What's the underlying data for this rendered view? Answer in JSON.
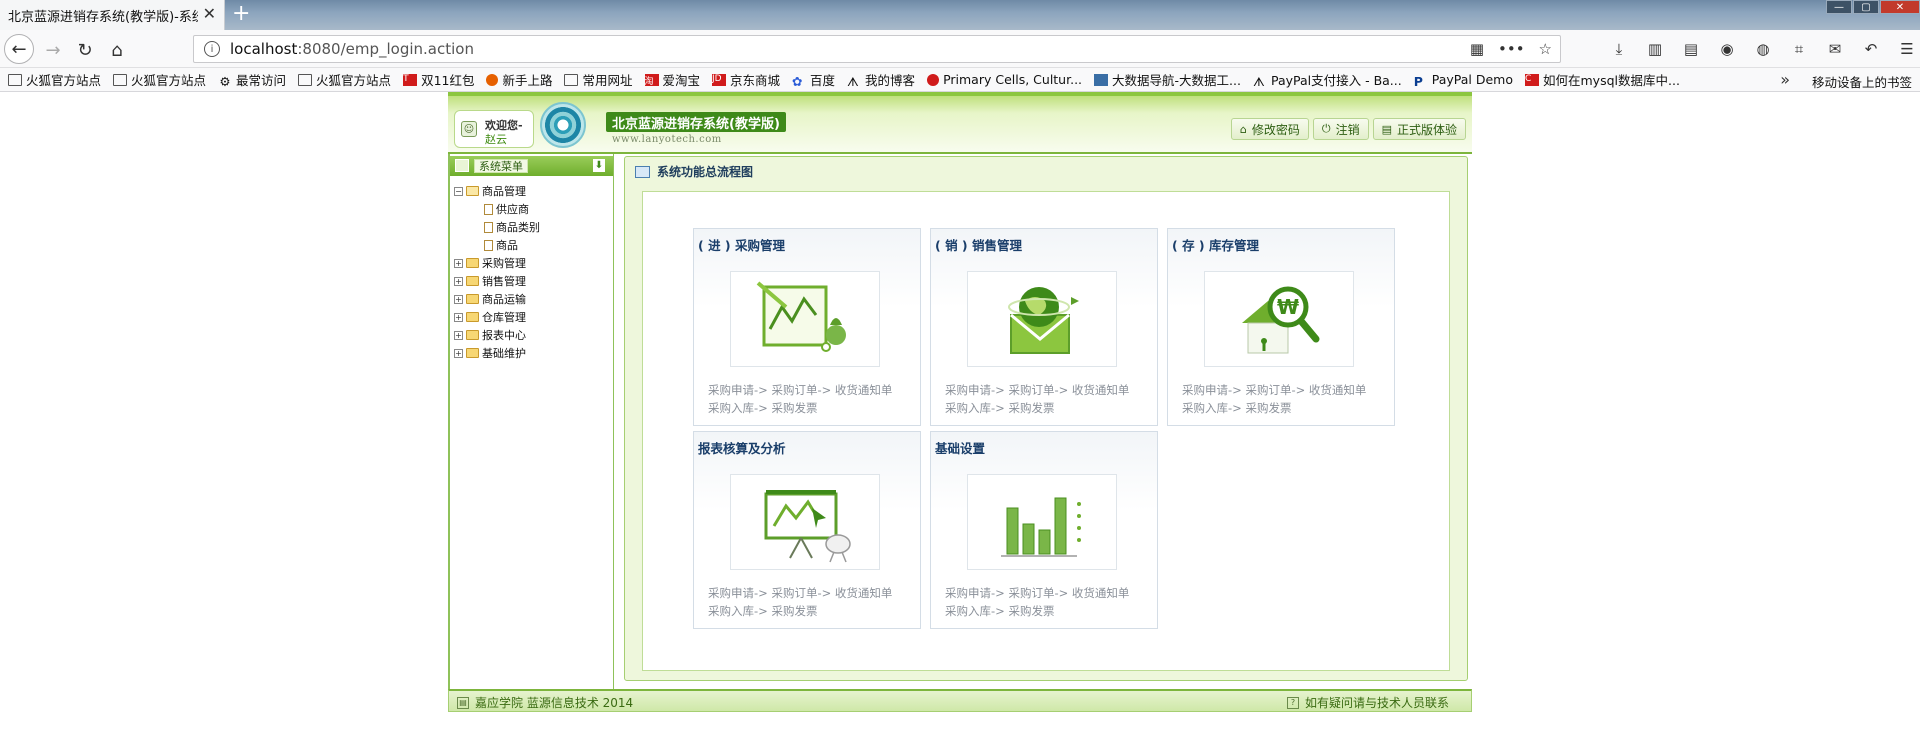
{
  "browser": {
    "tab_title": "北京蓝源进销存系统(教学版)-系统",
    "url_host": "localhost",
    "url_path": ":8080/emp_login.action",
    "bookmarks": [
      "火狐官方站点",
      "火狐官方站点",
      "最常访问",
      "火狐官方站点",
      "双11红包",
      "新手上路",
      "常用网址",
      "爱淘宝",
      "京东商城",
      "百度",
      "我的博客",
      "Primary Cells, Cultur...",
      "大数据导航-大数据工...",
      "PayPal支付接入 - Ba...",
      "PayPal Demo",
      "如何在mysql数据库中..."
    ],
    "mobile_bookmarks": "移动设备上的书签"
  },
  "header": {
    "welcome_label": "欢迎您-",
    "user_name": "赵云",
    "system_title": "北京蓝源进销存系统(教学版)",
    "system_url": "www.lanyotech.com",
    "buttons": {
      "change_password": "修改密码",
      "logout": "注销",
      "official": "正式版体验"
    }
  },
  "sidebar": {
    "title": "系统菜单",
    "tree": {
      "expanded": {
        "label": "商品管理",
        "children": [
          "供应商",
          "商品类别",
          "商品"
        ]
      },
      "collapsed": [
        "采购管理",
        "销售管理",
        "商品运输",
        "仓库管理",
        "报表中心",
        "基础维护"
      ]
    }
  },
  "main": {
    "panel_title": "系统功能总流程图",
    "cards": [
      {
        "title": "( 进 ) 采购管理",
        "line1": "采购申请-> 采购订单-> 收货通知单",
        "line2": "采购入库-> 采购发票",
        "icon": "chart-board-icon"
      },
      {
        "title": "( 销 ) 销售管理",
        "line1": "采购申请-> 采购订单-> 收货通知单",
        "line2": "采购入库-> 采购发票",
        "icon": "globe-envelope-icon"
      },
      {
        "title": "( 存 ) 库存管理",
        "line1": "采购申请-> 采购订单-> 收货通知单",
        "line2": "采购入库-> 采购发票",
        "icon": "house-magnifier-icon"
      },
      {
        "title": "报表核算及分析",
        "line1": "采购申请-> 采购订单-> 收货通知单",
        "line2": "采购入库-> 采购发票",
        "icon": "presentation-board-icon"
      },
      {
        "title": "基础设置",
        "line1": "采购申请-> 采购订单-> 收货通知单",
        "line2": "采购入库-> 采购发票",
        "icon": "bar-chart-icon"
      }
    ]
  },
  "footer": {
    "left": "嘉应学院 蓝源信息技术 2014",
    "right": "如有疑问请与技术人员联系"
  },
  "colors": {
    "brand_green": "#3e8a19",
    "header_green": "#8cc63f",
    "card_title_blue": "#1a3e6a",
    "flow_text_gray": "#8a9099"
  }
}
